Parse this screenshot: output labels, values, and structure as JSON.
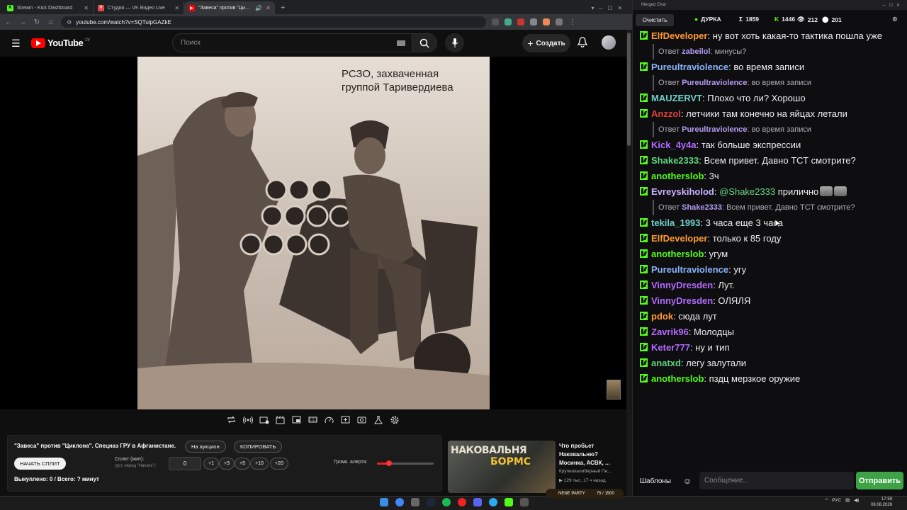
{
  "browser": {
    "tabs": [
      {
        "title": "Stream - Kick Dashboard",
        "color": "#53fc18"
      },
      {
        "title": "Студия — VK Видео Live",
        "color": "#e64646"
      },
      {
        "title": "\"Завеса\" против \"Циклона\"",
        "color": "#ff0000"
      }
    ],
    "url": "youtube.com/watch?v=SQTulpGAZkE"
  },
  "youtube": {
    "logo_text": "YouTube",
    "country": "LV",
    "search_placeholder": "Поиск",
    "create_label": "Создать",
    "video_caption_line1": "РСЗО, захваченная",
    "video_caption_line2": "группой Таривердиева"
  },
  "panel": {
    "title": "\"Завеса\" против \"Циклона\". Спецназ ГРУ в Афганистане.",
    "auction_label": "На аукцион",
    "copy_label": "КОПИРОВАТЬ",
    "start_split_label": "НАЧАТЬ СПЛИТ",
    "split_label": "Сплит (мин):",
    "split_hint": "(уст. перед \"Начать\")",
    "split_value": "0",
    "increments": [
      "+1",
      "+3",
      "+5",
      "+10",
      "+20"
    ],
    "volume_label": "Громк. алерта:",
    "volume_level": 0.2,
    "sold_line": "Выкуплено: 0 / Всего: ? минут"
  },
  "recommended": {
    "thumb_text1": "НАКОВАЛЬНЯ",
    "thumb_text2": "БОРМС",
    "title": "Что пробьет Наковальню? Мосинка, АСВК, ...",
    "channel": "Крупнокалиберный Пе...",
    "meta": "▶ 129 тыс.  17 ч назад"
  },
  "chat": {
    "window_title": "Merged Chat",
    "clear_label": "Очистить",
    "stats": [
      {
        "icon": "●",
        "value": "ДУРКА",
        "color": "#53fc18"
      },
      {
        "icon": "Σ",
        "value": "1859",
        "color": "#ffffff"
      },
      {
        "icon": "K",
        "value": "1446",
        "color": "#53fc18"
      },
      {
        "icon": "👁",
        "value": "212",
        "color": "#ffffff"
      },
      {
        "icon": "⬤",
        "value": "201",
        "color": "#ffffff"
      }
    ],
    "messages": [
      {
        "user": "ElfDeveloper",
        "color": "#ff9933",
        "text": "ну вот хоть какая-то тактика пошла уже"
      },
      {
        "reply": true,
        "prefix": "Ответ",
        "user": "zabeilol",
        "text": "минусы?"
      },
      {
        "user": "Pureultraviolence",
        "color": "#8ab4f8",
        "text": "во время записи"
      },
      {
        "reply": true,
        "prefix": "Ответ",
        "user": "Pureultraviolence",
        "text": "во время записи"
      },
      {
        "user": "MAUZERVT",
        "color": "#6fd0c7",
        "text": "Плохо что ли? Хорошо"
      },
      {
        "user": "Anzzol",
        "color": "#e0403a",
        "text": "летчики там конечно на яйцах летали"
      },
      {
        "reply": true,
        "prefix": "Ответ",
        "user": "Pureultraviolence",
        "text": "во время записи"
      },
      {
        "user": "Kick_4y4a",
        "color": "#b36bff",
        "text": "так больше экспрессии"
      },
      {
        "user": "Shake2333",
        "color": "#5fd47c",
        "text": "Всем привет. Давно ТСТ смотрите?"
      },
      {
        "user": "anotherslob",
        "color": "#53fc18",
        "text": "3ч"
      },
      {
        "user": "Evreyskiholod",
        "color": "#c9b3ff",
        "mention": "@Shake2333",
        "text": "прилично"
      },
      {
        "reply": true,
        "prefix": "Ответ",
        "user": "Shake2333",
        "text": "Всем привет. Давно ТСТ смотрите?"
      },
      {
        "user": "tekila_1993",
        "color": "#6fd0c7",
        "text": "3 часа еще 3 часа"
      },
      {
        "user": "ElfDeveloper",
        "color": "#ff9933",
        "text": "только к 85 году"
      },
      {
        "user": "anotherslob",
        "color": "#53fc18",
        "text": "угум"
      },
      {
        "user": "Pureultraviolence",
        "color": "#8ab4f8",
        "text": "угу"
      },
      {
        "user": "VinnyDresden",
        "color": "#b36bff",
        "text": "Лут."
      },
      {
        "user": "VinnyDresden",
        "color": "#b36bff",
        "text": "ОЛЯЛЯ"
      },
      {
        "user": "pdok",
        "color": "#ff9933",
        "text": "сюда лут"
      },
      {
        "user": "Zavrik96",
        "color": "#b36bff",
        "text": "Молодцы"
      },
      {
        "user": "Keter777",
        "color": "#b36bff",
        "text": "ну и тип"
      },
      {
        "user": "anatxd",
        "color": "#5fd47c",
        "text": "легу залутали"
      },
      {
        "user": "anotherslob",
        "color": "#53fc18",
        "text": "пздц мерзкое оружие"
      }
    ],
    "templates_label": "Шаблоны",
    "input_placeholder": "Сообщение...",
    "send_label": "Отправить"
  },
  "taskbar": {
    "lang": "РУС",
    "time": "17:59",
    "date": "08.08.2026",
    "nene_label": "NENE PARTY",
    "nene_count": "75 / 1500"
  }
}
